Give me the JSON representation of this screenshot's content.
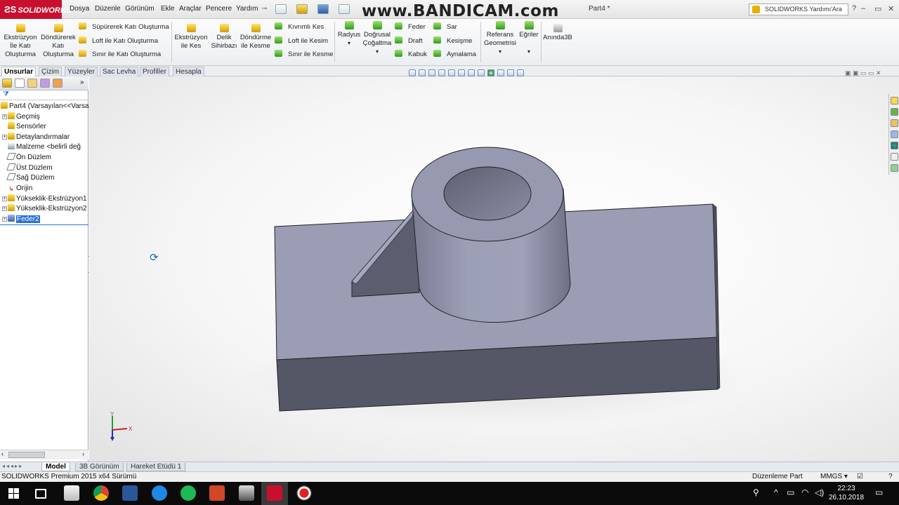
{
  "app": {
    "logo": "SOLIDWORKS",
    "doc_title": "Part4 *",
    "watermark": "www.BANDICAM.com"
  },
  "menu": [
    "Dosya",
    "Düzenle",
    "Görünüm",
    "Ekle",
    "Araçlar",
    "Pencere",
    "Yardım"
  ],
  "search": {
    "placeholder": "SOLIDWORKS Yardımı'Ara"
  },
  "ribbon": {
    "big": [
      {
        "label": "Ekstrüzyon İle Katı Oluşturma"
      },
      {
        "label": "Döndürerek Katı Oluşturma"
      },
      {
        "label": "Ekstrüzyon ile Kes"
      },
      {
        "label": "Delik Sihirbazı"
      },
      {
        "label": "Döndürme ile Kesme"
      },
      {
        "label": "Radyus"
      },
      {
        "label": "Doğrusal Çoğaltma"
      },
      {
        "label": "Referans Geometrisi"
      },
      {
        "label": "Eğriler"
      },
      {
        "label": "Anında3B"
      }
    ],
    "col1": [
      "Süpürerek Katı Oluşturma",
      "Loft ile Katı Oluşturma",
      "Sınır ile Katı Oluşturma"
    ],
    "col2": [
      "Kıvrımlı Kes",
      "Loft ile Kesim",
      "Sınır ile Kesme"
    ],
    "col3": [
      "Feder",
      "Draft",
      "Kabuk"
    ],
    "col4": [
      "Sar",
      "Kesişme",
      "Aynalama"
    ]
  },
  "tabs": [
    "Unsurlar",
    "Çizim",
    "Yüzeyler",
    "Sac Levha",
    "Profiller",
    "Hesapla"
  ],
  "active_tab": "Unsurlar",
  "tree": [
    {
      "label": "Part4  (Varsayılan<<Varsa",
      "root": true
    },
    {
      "label": "Geçmiş"
    },
    {
      "label": "Sensörler"
    },
    {
      "label": "Detaylandırmalar"
    },
    {
      "label": "Malzeme <belirli değ"
    },
    {
      "label": "Ön Düzlem"
    },
    {
      "label": "Üst Düzlem"
    },
    {
      "label": "Sağ Düzlem"
    },
    {
      "label": "Orijin"
    },
    {
      "label": "Yükseklik-Ekstrüzyon1"
    },
    {
      "label": "Yükseklik-Ekstrüzyon2"
    },
    {
      "label": "Feder2",
      "selected": true
    }
  ],
  "triad": {
    "x": "X",
    "y": "Y"
  },
  "bottom_tabs": [
    "Model",
    "3B Görünüm",
    "Hareket Etüdü 1"
  ],
  "status": {
    "left": "SOLIDWORKS Premium 2015 x64 Sürümü",
    "mode": "Düzenleme Part",
    "units": "MMGS"
  },
  "taskbar": {
    "time": "22:23",
    "date": "26.10.2018"
  },
  "colors": {
    "solidworks_red": "#c8102e",
    "model_top": "#9a9db4",
    "model_side": "#555766",
    "selection": "#2a6fd6"
  }
}
